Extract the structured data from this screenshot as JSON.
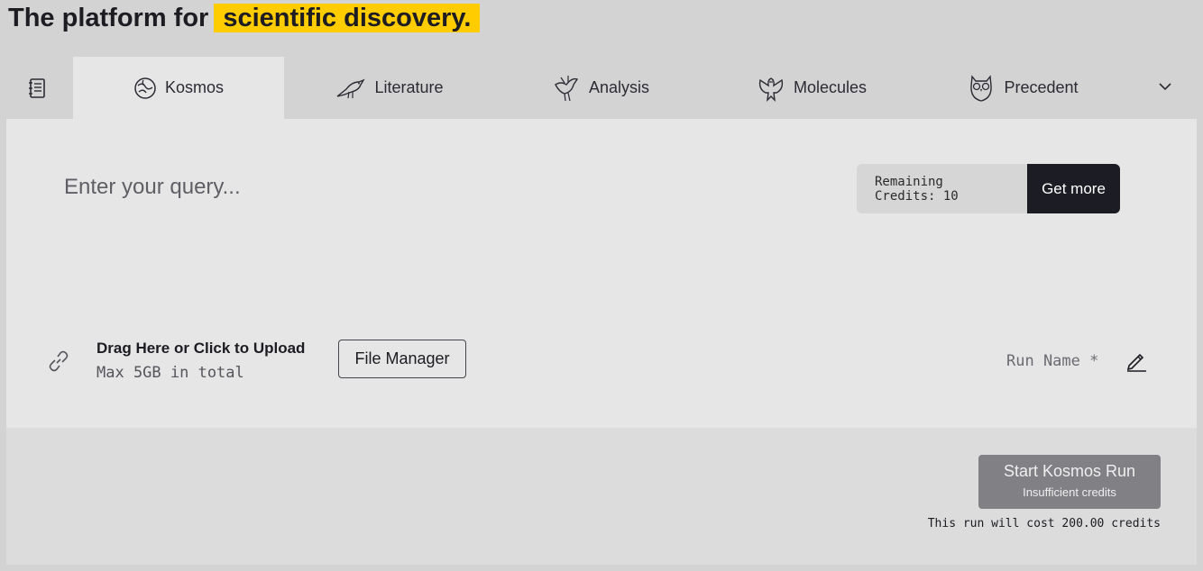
{
  "headline": {
    "prefix": "The platform for",
    "highlight": "scientific discovery."
  },
  "tabs": [
    {
      "label": "",
      "icon": "notebook-icon"
    },
    {
      "label": "Kosmos",
      "icon": "brain-icon",
      "active": true
    },
    {
      "label": "Literature",
      "icon": "crow-icon"
    },
    {
      "label": "Analysis",
      "icon": "finch-icon"
    },
    {
      "label": "Molecules",
      "icon": "eagle-icon"
    },
    {
      "label": "Precedent",
      "icon": "owl-icon"
    }
  ],
  "query": {
    "placeholder": "Enter your query..."
  },
  "credits": {
    "label": "Remaining Credits: 10",
    "button": "Get more"
  },
  "upload": {
    "title": "Drag Here or Click to Upload",
    "subtitle": "Max 5GB in total",
    "file_manager": "File Manager"
  },
  "run": {
    "name_label": "Run Name *"
  },
  "footer": {
    "start_button": "Start Kosmos Run",
    "start_sub": "Insufficient credits",
    "cost_text": "This run will cost 200.00 credits"
  },
  "colors": {
    "highlight": "#ffcc00",
    "dark_button": "#1c1d24",
    "disabled_button": "#818185"
  }
}
